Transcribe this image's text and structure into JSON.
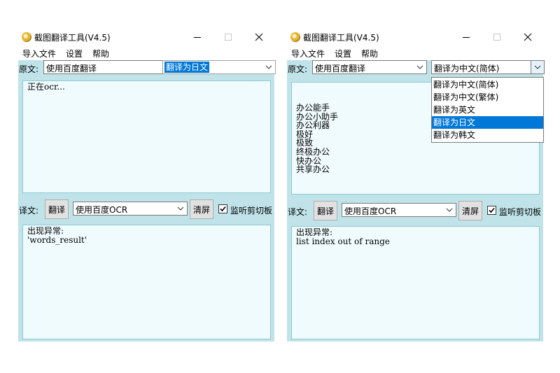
{
  "window1": {
    "title": "截图翻译工具(V4.5)",
    "menu": [
      "导入文件",
      "设置",
      "帮助"
    ],
    "source_label": "原文:",
    "source_engine": "使用百度翻译",
    "target_language": "翻译为日文",
    "source_text": "正在ocr...",
    "translate_label": "译文:",
    "translate_button": "翻译",
    "ocr_engine": "使用百度OCR",
    "clear_button": "清屏",
    "clipboard_label": "监听剪切板",
    "clipboard_checked": true,
    "result_text": "出现异常:\n'words_result'"
  },
  "window2": {
    "title": "截图翻译工具(V4.5)",
    "menu": [
      "导入文件",
      "设置",
      "帮助"
    ],
    "source_label": "原文:",
    "source_engine": "使用百度翻译",
    "target_language": "翻译为中文(简体)",
    "source_text": "办公能手\n办公小助手\n办公利器\n极好\n极致\n终极办公\n快办公\n共享办公",
    "translate_label": "译文:",
    "translate_button": "翻译",
    "ocr_engine": "使用百度OCR",
    "clear_button": "清屏",
    "clipboard_label": "监听剪切板",
    "clipboard_checked": true,
    "result_text": "出现异常:\nlist index out of range",
    "dropdown_options": [
      "翻译为中文(简体)",
      "翻译为中文(繁体)",
      "翻译为英文",
      "翻译为日文",
      "翻译为韩文"
    ],
    "dropdown_highlighted": "翻译为日文"
  },
  "colors": {
    "panel_bg": "#bfe3e9",
    "textarea_bg": "#f0fbfd",
    "highlight": "#0078d7"
  }
}
